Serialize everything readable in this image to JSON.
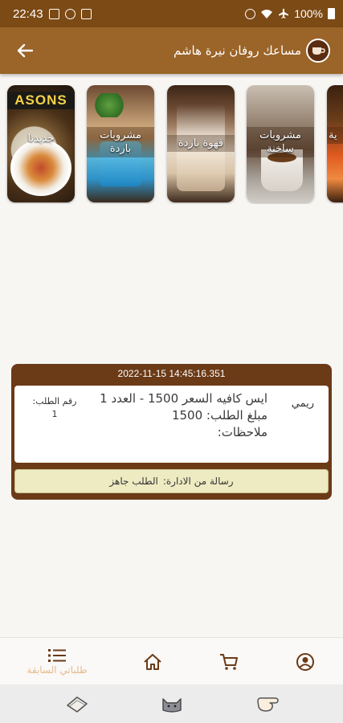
{
  "status_bar": {
    "time": "22:43",
    "battery": "100%"
  },
  "app_bar": {
    "title": "مساعك روفان نيرة هاشم"
  },
  "categories": [
    {
      "label": "جديدنا",
      "banner": "ASONS"
    },
    {
      "label": "مشروبات باردة"
    },
    {
      "label": "قهوة باردة"
    },
    {
      "label": "مشروبات ساخنة"
    },
    {
      "label": "ية"
    }
  ],
  "order": {
    "timestamp": "2022-11-15 14:45:16.351",
    "customer": "ريمي",
    "item_line": "ايس كافيه السعر 1500 - العدد 1",
    "amount_line": "مبلغ الطلب: 1500",
    "notes_line": "ملاحظات:",
    "order_number_label": "رقم الطلب:",
    "order_number": "1",
    "admin_message_label": "رسالة من الادارة:",
    "admin_message": "الطلب جاهز"
  },
  "bottom_nav": {
    "previous_orders_label": "طلباتي السابقة",
    "active_color": "#e8b98a"
  },
  "colors": {
    "status_bar": "#7c4a15",
    "app_bar": "#9b6428",
    "order_card": "#6b3a16",
    "admin_message_bg": "#eeebc2"
  }
}
